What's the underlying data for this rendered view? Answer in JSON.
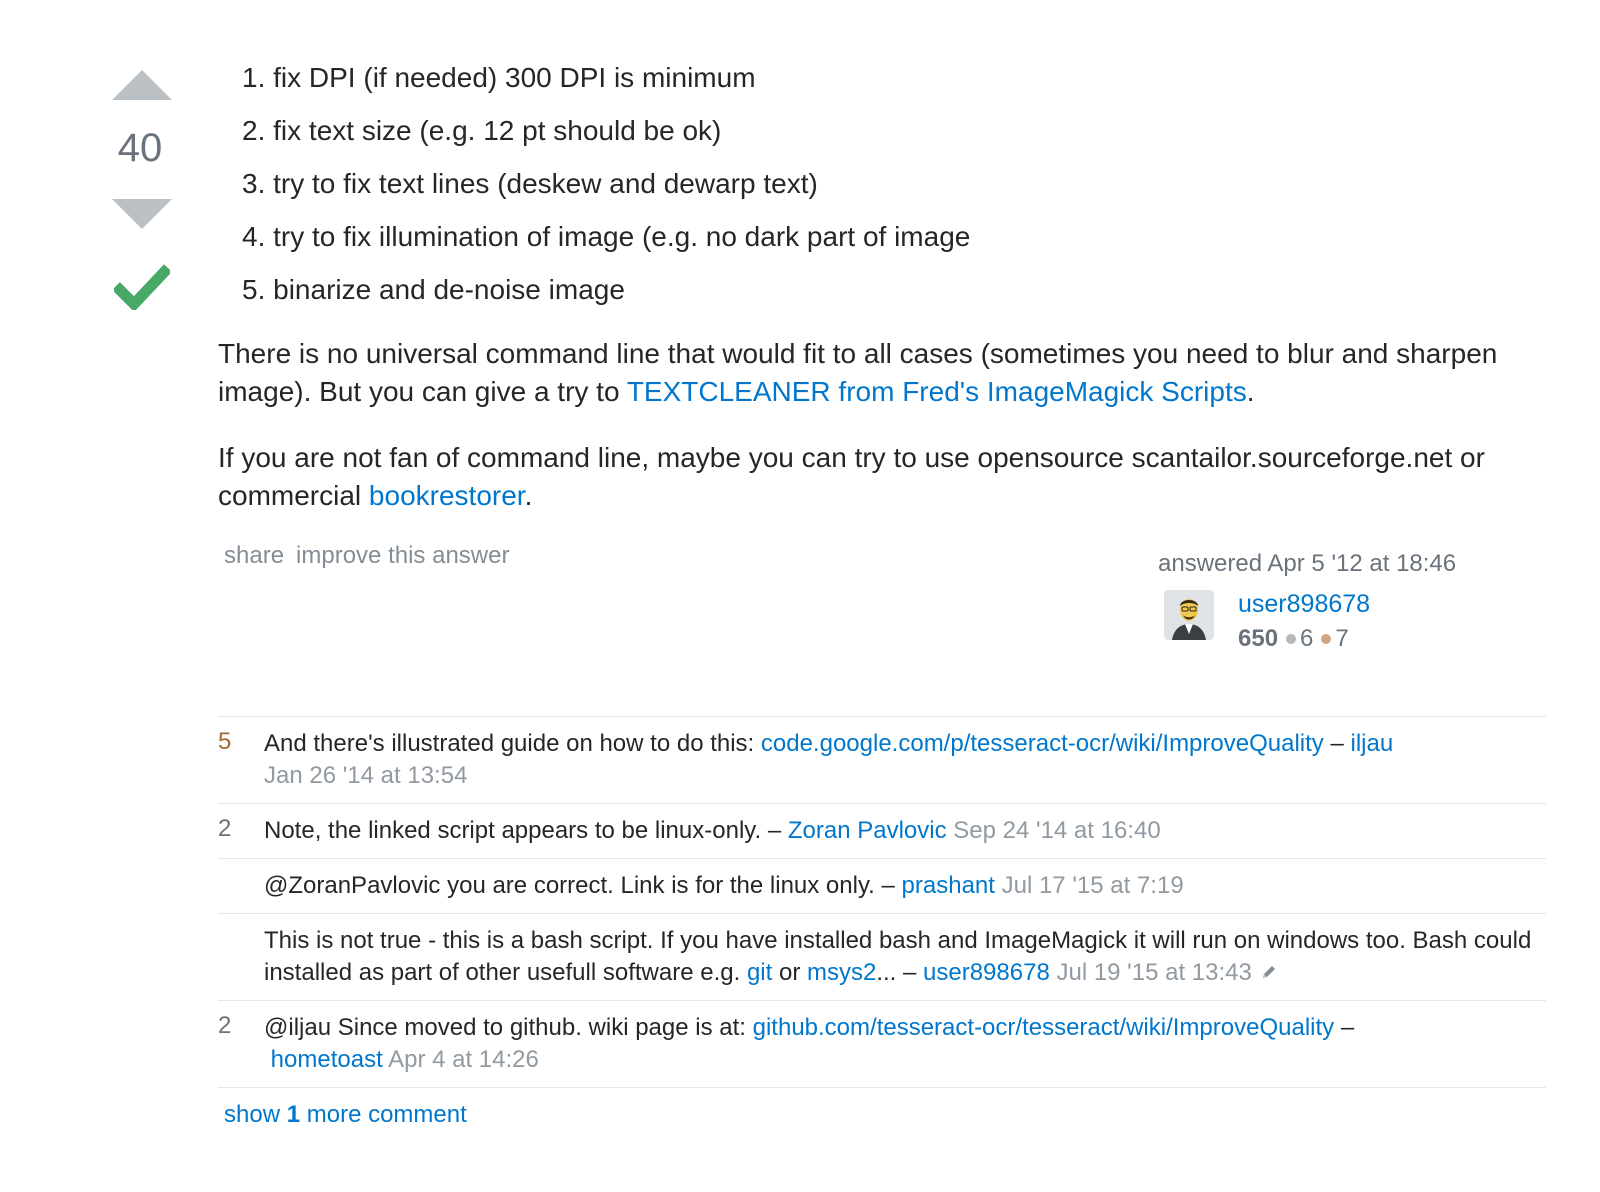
{
  "vote": {
    "count": "40"
  },
  "steps": [
    "1. fix DPI (if needed) 300 DPI is minimum",
    "2. fix text size (e.g. 12 pt should be ok)",
    "3. try to fix text lines (deskew and dewarp text)",
    "4. try to fix illumination of image (e.g. no dark part of image",
    "5. binarize and de-noise image"
  ],
  "para1": {
    "text_a": "There is no universal command line that would fit to all cases (sometimes you need to blur and sharpen image). But you can give a try to ",
    "link": "TEXTCLEANER from Fred's ImageMagick Scripts",
    "text_b": "."
  },
  "para2": {
    "text_a": "If you are not fan of command line, maybe you can try to use opensource scantailor.sourceforge.net or commercial ",
    "link": "bookrestorer",
    "text_b": "."
  },
  "actions": {
    "share": "share",
    "improve": "improve this answer"
  },
  "signature": {
    "answered": "answered Apr 5 '12 at 18:46",
    "user": "user898678",
    "rep": "650",
    "silver": "6",
    "bronze": "7"
  },
  "comments": [
    {
      "score": "5",
      "text": "And there's illustrated guide on how to do this: ",
      "link": "code.google.com/p/tesseract-ocr/wiki/ImproveQuality",
      "dash": " – ",
      "user": "iljau",
      "date": "Jan 26 '14 at 13:54"
    },
    {
      "score": "2",
      "text": "Note, the linked script appears to be linux-only. – ",
      "user": "Zoran Pavlovic",
      "date": "Sep 24 '14 at 16:40"
    },
    {
      "score": "",
      "text": "@ZoranPavlovic you are correct. Link is for the linux only. – ",
      "user": "prashant",
      "date": "Jul 17 '15 at 7:19"
    },
    {
      "score": "",
      "text_a": "This is not true - this is a bash script. If you have installed bash and ImageMagick it will run on windows too. Bash could installed as part of other usefull software e.g. ",
      "link1": "git",
      "or": " or ",
      "link2": "msys2",
      "text_b": "... – ",
      "user": "user898678",
      "date": "Jul 19 '15 at 13:43",
      "edit_icon": "pencil-icon"
    },
    {
      "score": "2",
      "text": "@iljau Since moved to github. wiki page is at: ",
      "link": "github.com/tesseract-ocr/tesseract/wiki/ImproveQuality",
      "dash": " –",
      "user": "hometoast",
      "date": "Apr 4 at 14:26"
    }
  ],
  "show_more": {
    "pre": "show ",
    "count": "1",
    "post": " more comment"
  },
  "colors": {
    "link": "#0077cc",
    "accepted": "#48a868",
    "arrow": "#bbc0c4"
  }
}
